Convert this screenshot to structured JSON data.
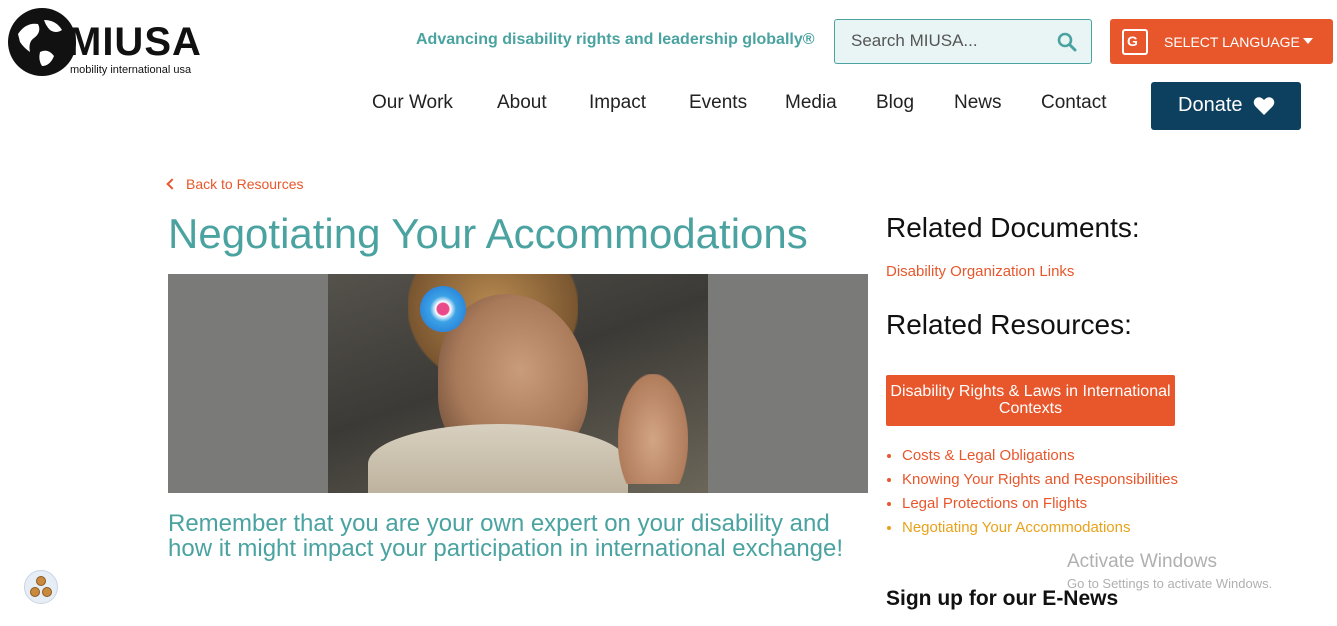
{
  "header": {
    "logo_text": "MIUSA",
    "logo_subtext": "mobility international usa",
    "tagline": "Advancing disability rights and leadership globally®",
    "search_placeholder": "Search MIUSA...",
    "language_label": "SELECT LANGUAGE",
    "donate_label": "Donate"
  },
  "nav": {
    "items": [
      {
        "label": "Our Work"
      },
      {
        "label": "About"
      },
      {
        "label": "Impact"
      },
      {
        "label": "Events"
      },
      {
        "label": "Media"
      },
      {
        "label": "Blog"
      },
      {
        "label": "News"
      },
      {
        "label": "Contact"
      }
    ]
  },
  "main": {
    "back_link": "Back to Resources",
    "title": "Negotiating Your Accommodations",
    "lead": "Remember that you are your own expert on your disability and how it might impact your participation in international exchange!"
  },
  "sidebar": {
    "related_documents_heading": "Related Documents:",
    "related_documents": [
      {
        "label": "Disability Organization Links"
      }
    ],
    "related_resources_heading": "Related Resources:",
    "resource_button": "Disability Rights & Laws in International Contexts",
    "resources": [
      {
        "label": "Costs & Legal Obligations"
      },
      {
        "label": "Knowing Your Rights and Responsibilities"
      },
      {
        "label": "Legal Protections on Flights"
      },
      {
        "label": "Negotiating Your Accommodations"
      }
    ],
    "signup_heading": "Sign up for our E-News"
  },
  "overlay": {
    "windows_title": "Activate Windows",
    "windows_sub": "Go to Settings to activate Windows."
  },
  "colors": {
    "teal": "#4aa3a0",
    "orange": "#e8572c",
    "navy": "#0d3f5f",
    "gold": "#e8a21a"
  }
}
